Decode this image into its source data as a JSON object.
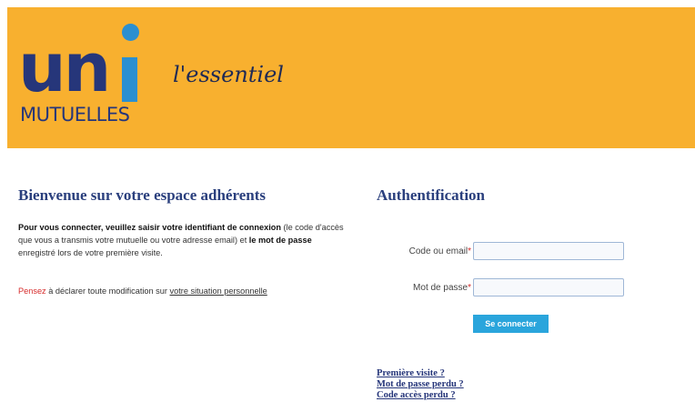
{
  "brand": {
    "logo_uni": "un",
    "logo_mutuelles": "MUTUELLES",
    "tagline": "l'essentiel",
    "colors": {
      "banner": "#f8b02f",
      "logo_navy": "#26367a",
      "logo_blue": "#2b8fd0"
    }
  },
  "welcome": {
    "title": "Bienvenue sur votre espace adhérents",
    "intro_bold": "Pour vous connecter, veuillez saisir votre identifiant de connexion",
    "intro_text": " (le code d'accès que vous a transmis votre mutuelle ou votre adresse email) et ",
    "intro_bold2": "le mot de passe",
    "intro_text2": " enregistré lors de votre première visite.",
    "reminder_red": "Pensez",
    "reminder_text": " à déclarer toute modification sur ",
    "reminder_link": "votre situation personnelle"
  },
  "auth": {
    "title": "Authentification",
    "code_label": "Code ou email",
    "password_label": "Mot de passe",
    "required_mark": "*",
    "code_value": "",
    "password_value": "",
    "submit_label": "Se connecter",
    "links": [
      "Première visite ?",
      "Mot de passe perdu ?",
      "Code accès perdu ?"
    ]
  }
}
